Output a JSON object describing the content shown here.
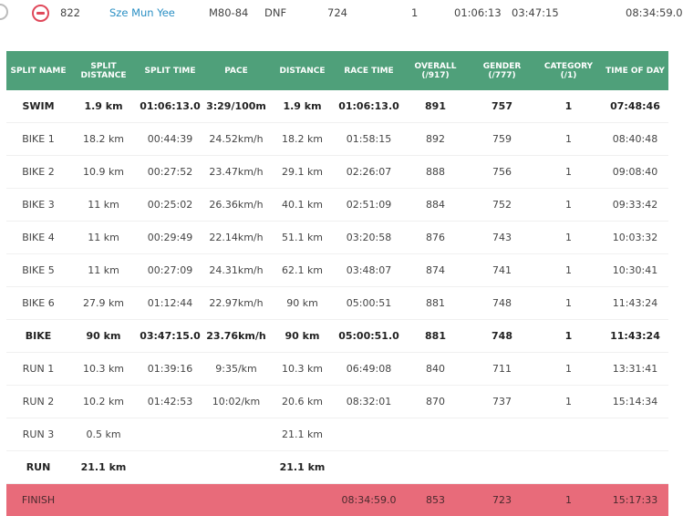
{
  "top_row": {
    "bib": "822",
    "name": "Sze Mun Yee",
    "division": "M80-84",
    "status": "DNF",
    "rank": "724",
    "count": "1",
    "swim": "01:06:13",
    "bike": "03:47:15",
    "time_of_day": "08:34:59.0"
  },
  "table": {
    "headers": [
      "SPLIT NAME",
      "SPLIT DISTANCE",
      "SPLIT TIME",
      "PACE",
      "DISTANCE",
      "RACE TIME",
      "OVERALL (/917)",
      "GENDER (/777)",
      "CATEGORY (/1)",
      "TIME OF DAY"
    ],
    "rows": [
      {
        "cells": [
          "SWIM",
          "1.9 km",
          "01:06:13.0",
          "3:29/100m",
          "1.9 km",
          "01:06:13.0",
          "891",
          "757",
          "1",
          "07:48:46"
        ],
        "type": "total"
      },
      {
        "cells": [
          "BIKE 1",
          "18.2 km",
          "00:44:39",
          "24.52km/h",
          "18.2 km",
          "01:58:15",
          "892",
          "759",
          "1",
          "08:40:48"
        ],
        "type": "normal"
      },
      {
        "cells": [
          "BIKE 2",
          "10.9 km",
          "00:27:52",
          "23.47km/h",
          "29.1 km",
          "02:26:07",
          "888",
          "756",
          "1",
          "09:08:40"
        ],
        "type": "normal"
      },
      {
        "cells": [
          "BIKE 3",
          "11 km",
          "00:25:02",
          "26.36km/h",
          "40.1 km",
          "02:51:09",
          "884",
          "752",
          "1",
          "09:33:42"
        ],
        "type": "normal"
      },
      {
        "cells": [
          "BIKE 4",
          "11 km",
          "00:29:49",
          "22.14km/h",
          "51.1 km",
          "03:20:58",
          "876",
          "743",
          "1",
          "10:03:32"
        ],
        "type": "normal"
      },
      {
        "cells": [
          "BIKE 5",
          "11 km",
          "00:27:09",
          "24.31km/h",
          "62.1 km",
          "03:48:07",
          "874",
          "741",
          "1",
          "10:30:41"
        ],
        "type": "normal"
      },
      {
        "cells": [
          "BIKE 6",
          "27.9 km",
          "01:12:44",
          "22.97km/h",
          "90 km",
          "05:00:51",
          "881",
          "748",
          "1",
          "11:43:24"
        ],
        "type": "normal"
      },
      {
        "cells": [
          "BIKE",
          "90 km",
          "03:47:15.0",
          "23.76km/h",
          "90 km",
          "05:00:51.0",
          "881",
          "748",
          "1",
          "11:43:24"
        ],
        "type": "total"
      },
      {
        "cells": [
          "RUN 1",
          "10.3 km",
          "01:39:16",
          "9:35/km",
          "10.3 km",
          "06:49:08",
          "840",
          "711",
          "1",
          "13:31:41"
        ],
        "type": "normal"
      },
      {
        "cells": [
          "RUN 2",
          "10.2 km",
          "01:42:53",
          "10:02/km",
          "20.6 km",
          "08:32:01",
          "870",
          "737",
          "1",
          "15:14:34"
        ],
        "type": "normal"
      },
      {
        "cells": [
          "RUN 3",
          "0.5 km",
          "",
          "",
          "21.1 km",
          "",
          "",
          "",
          "",
          ""
        ],
        "type": "normal"
      },
      {
        "cells": [
          "RUN",
          "21.1 km",
          "",
          "",
          "21.1 km",
          "",
          "",
          "",
          "",
          ""
        ],
        "type": "total"
      },
      {
        "cells": [
          "FINISH",
          "",
          "",
          "",
          "",
          "08:34:59.0",
          "853",
          "723",
          "1",
          "15:17:33"
        ],
        "type": "finish"
      }
    ]
  },
  "colors": {
    "header_bg": "#4fa07a",
    "finish_bg": "#e86b7a",
    "link": "#2a8fc4",
    "remove_icon": "#e0485a"
  }
}
